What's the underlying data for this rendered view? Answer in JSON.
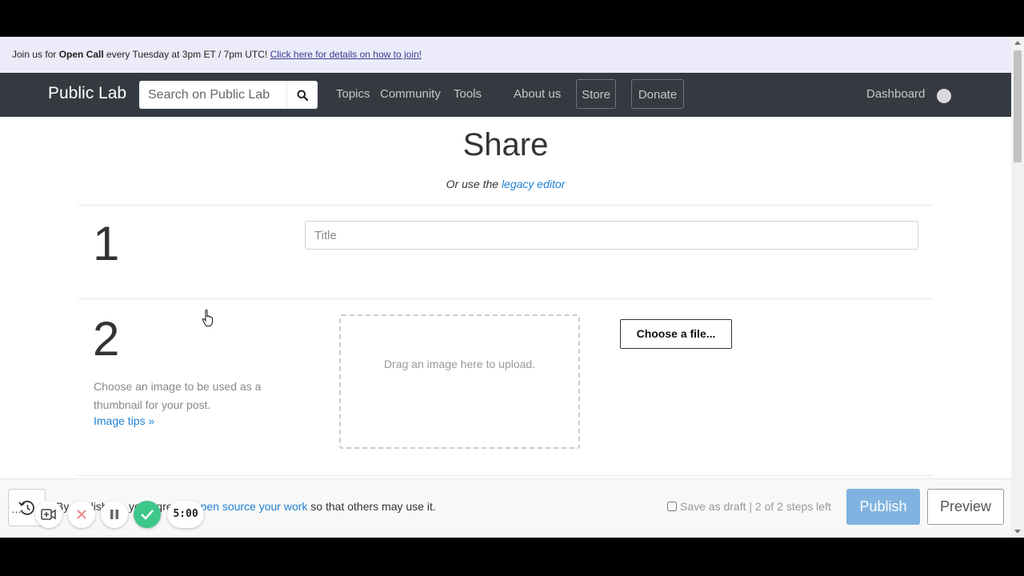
{
  "announcement": {
    "prefix": "Join us for ",
    "highlight": "Open Call",
    "middle": " every Tuesday at 3pm ET / 7pm UTC! ",
    "link": "Click here for details on how to join!"
  },
  "navbar": {
    "brand": "Public Lab",
    "search_placeholder": "Search on Public Lab",
    "links": [
      "Topics",
      "Community",
      "Tools",
      "About us"
    ],
    "store": "Store",
    "donate": "Donate",
    "dashboard": "Dashboard"
  },
  "header": {
    "title": "Share",
    "legacy_prefix": "Or use the ",
    "legacy_link": "legacy editor"
  },
  "step1": {
    "number": "1",
    "title_placeholder": "Title"
  },
  "step2": {
    "number": "2",
    "help": "Choose an image to be used as a thumbnail for your post.",
    "tips": "Image tips »",
    "dropzone": "Drag an image here to upload.",
    "choose_file": "Choose a file..."
  },
  "footer": {
    "license_prefix": "By publishing, you agree to ",
    "license_link": "open source your work",
    "license_suffix": " so that others may use it.",
    "draft": "Save as draft | 2 of 2 steps left",
    "publish": "Publish",
    "preview": "Preview"
  },
  "recorder": {
    "more": "···",
    "timer": "5:00"
  },
  "colors": {
    "navbar": "#343a40",
    "link": "#1f7fd1",
    "publish": "#80b3df",
    "announce_bg": "#ecebfa"
  }
}
